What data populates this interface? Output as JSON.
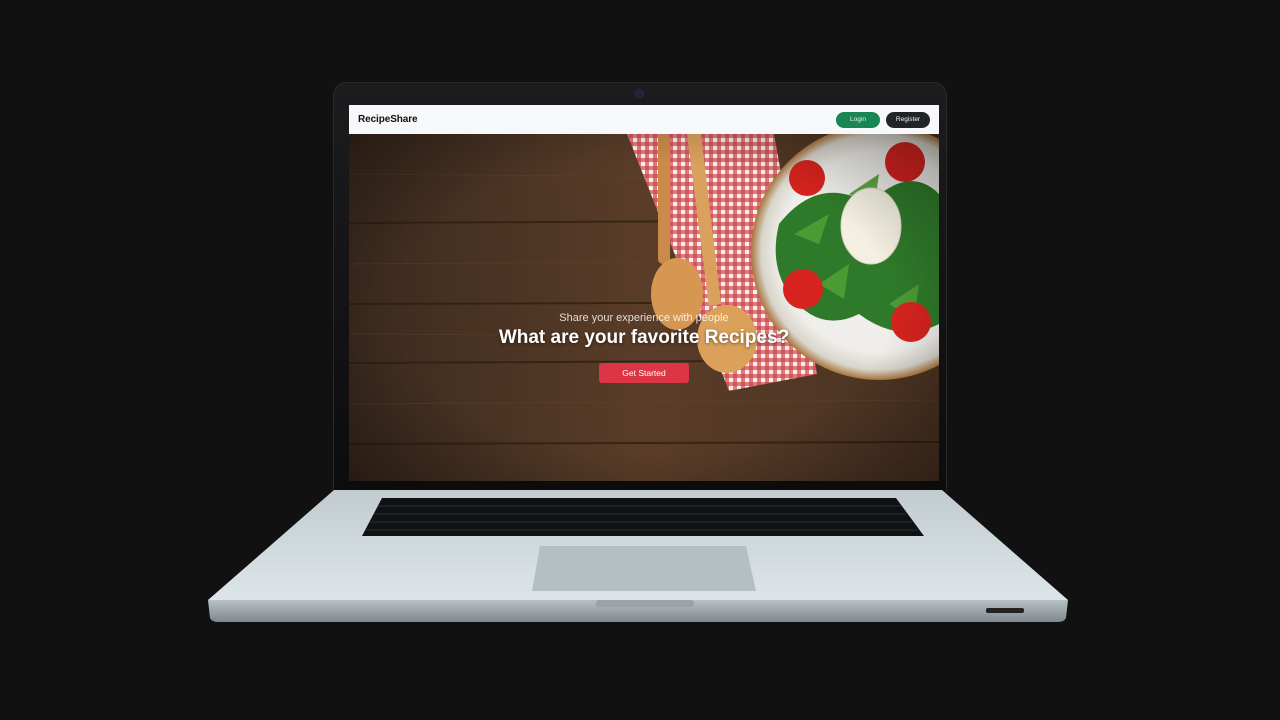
{
  "navbar": {
    "brand": "RecipeShare",
    "login_label": "Login",
    "register_label": "Register"
  },
  "hero": {
    "subtitle": "Share your experience with people",
    "title": "What are your favorite Recipes?",
    "cta_label": "Get Started"
  },
  "colors": {
    "login_button": "#198754",
    "register_button": "#212529",
    "cta_button": "#dc3545",
    "navbar_bg": "#f7f8fa"
  }
}
